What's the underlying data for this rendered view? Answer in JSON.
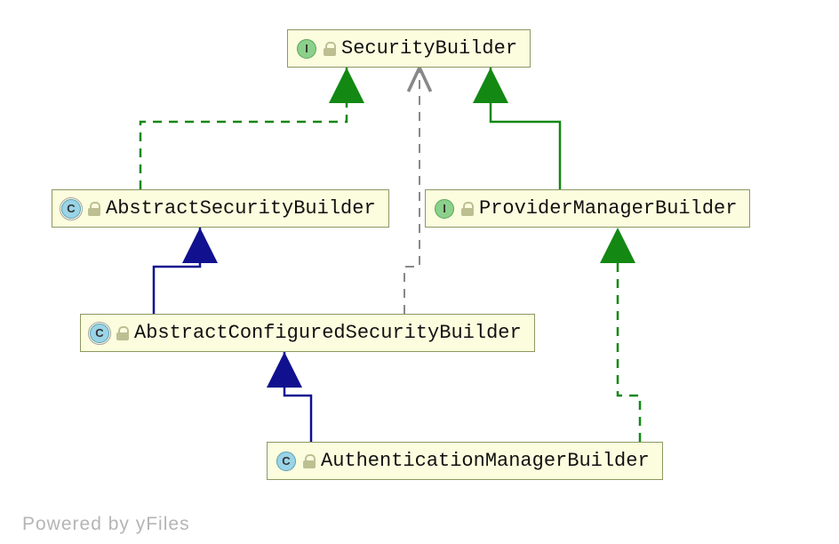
{
  "nodes": {
    "security_builder": {
      "label": "SecurityBuilder",
      "type_letter": "I",
      "kind": "interface"
    },
    "abstract_security_builder": {
      "label": "AbstractSecurityBuilder",
      "type_letter": "C",
      "kind": "class",
      "abstract": true
    },
    "provider_manager_builder": {
      "label": "ProviderManagerBuilder",
      "type_letter": "I",
      "kind": "interface"
    },
    "abstract_configured_security_builder": {
      "label": "AbstractConfiguredSecurityBuilder",
      "type_letter": "C",
      "kind": "class",
      "abstract": true
    },
    "authentication_manager_builder": {
      "label": "AuthenticationManagerBuilder",
      "type_letter": "C",
      "kind": "class"
    }
  },
  "footer": "Powered by yFiles",
  "colors": {
    "node_fill": "#fcfcde",
    "node_border": "#8b9862",
    "arrow_extends": "#11118f",
    "arrow_implements": "#138813",
    "arrow_dep": "#888888"
  }
}
